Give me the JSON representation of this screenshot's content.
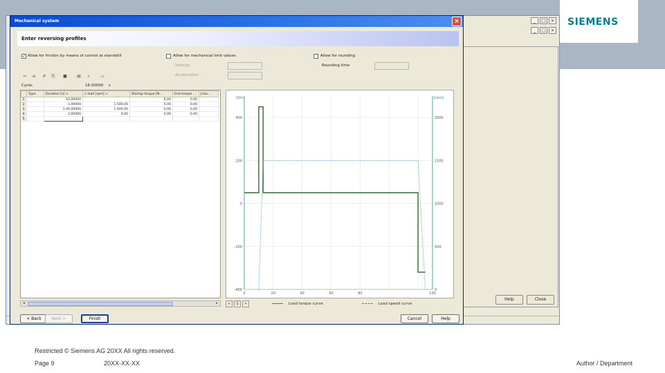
{
  "brand": {
    "logo_text": "SIEMENS",
    "accent": "#0a7d8c",
    "band_color": "#a9b7c4"
  },
  "footer": {
    "copyright": "Restricted © Siemens AG 20XX All rights reserved.",
    "page": "Page 9",
    "date": "20XX-XX-XX",
    "author": "Author / Department"
  },
  "background_window": {
    "buttons": {
      "help": "Help",
      "close": "Close"
    }
  },
  "dialog": {
    "title": "Mechanical system",
    "banner": "Enter reversing profiles",
    "options": {
      "friction": {
        "label": "Allow for friction by means of control at standstill",
        "checked": true
      },
      "mechanical_limits": {
        "label": "Allow for mechanical limit values",
        "checked": false
      },
      "rounding": {
        "label": "Allow for rounding",
        "checked": false
      }
    },
    "fields": {
      "velocity_label": "Velocity",
      "acceleration_label": "Acceleration",
      "rounding_time_label": "Rounding time",
      "cycle_label": "Cycle:",
      "cycle_value": "16.00000",
      "cycle_unit": "s"
    },
    "table": {
      "columns": [
        "Type",
        "Duration [s] >",
        "n load [rpm] >",
        "Startup torque [N...",
        "End torque ...",
        "J-loa..."
      ],
      "rows": [
        {
          "index": "1",
          "duration": "10,00000",
          "speed": "",
          "start": "0,00",
          "end": "0,00"
        },
        {
          "index": "2",
          "duration": "1,00000",
          "speed": "1.500,00",
          "start": "0,00",
          "end": "0,00"
        },
        {
          "index": "3",
          "duration": "1.00,00000",
          "speed": "1.500,00",
          "start": "0,00",
          "end": "0,00"
        },
        {
          "index": "4",
          "duration": "3,00000",
          "speed": "0,00",
          "start": "0,00",
          "end": "0,00"
        },
        {
          "index": "5",
          "duration": "",
          "speed": "",
          "start": "",
          "end": ""
        }
      ]
    },
    "nav": {
      "prev": "«",
      "page": "1",
      "next": "»"
    },
    "legend": {
      "torque": "Load torque curve",
      "speed": "Load speed curve"
    },
    "buttons": {
      "back": "< Back",
      "next": "Next >",
      "finish": "Finish",
      "cancel": "Cancel",
      "help": "Help"
    }
  },
  "chart_data": {
    "type": "line",
    "left_axis": {
      "label": "[Nm]",
      "ticks": [
        400,
        200,
        0,
        -200,
        -400
      ],
      "range": [
        -400,
        500
      ]
    },
    "right_axis": {
      "label": "[rpm]",
      "ticks": [
        2000,
        1500,
        1000,
        500,
        0
      ],
      "range": [
        0,
        2250
      ]
    },
    "x_axis": {
      "ticks": [
        0,
        20,
        40,
        60,
        80,
        100,
        120,
        130
      ],
      "tick_labels": [
        "0",
        "20",
        "40",
        "60",
        "80",
        "",
        "",
        "130"
      ],
      "range": [
        0,
        130
      ]
    },
    "grid": true,
    "series": [
      {
        "name": "Load torque curve",
        "color": "#2f6e2f",
        "x": [
          0,
          10,
          10,
          13,
          13,
          120,
          120,
          125
        ],
        "y": [
          50,
          50,
          450,
          450,
          50,
          50,
          -320,
          -320
        ]
      },
      {
        "name": "Load speed curve",
        "color": "#5aa3d8",
        "x": [
          10,
          13,
          120,
          125
        ],
        "y": [
          0,
          1500,
          1500,
          0
        ]
      }
    ]
  }
}
